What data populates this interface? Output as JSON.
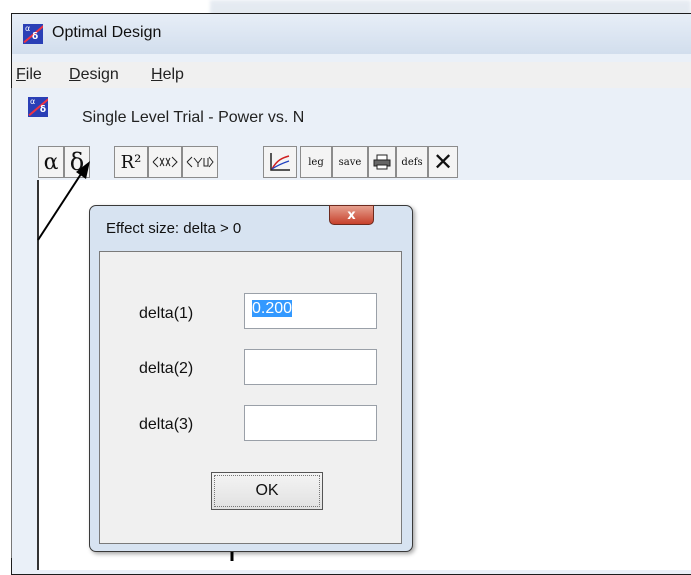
{
  "window": {
    "title": "Optimal Design"
  },
  "menu": [
    {
      "key": "F",
      "rest": "ile"
    },
    {
      "key": "D",
      "rest": "esign"
    },
    {
      "key": "H",
      "rest": "elp"
    }
  ],
  "child_window": {
    "title": "Single Level Trial - Power vs. N"
  },
  "toolbar": {
    "alpha": "α",
    "delta": "δ",
    "r2": "R²",
    "leg": "leg",
    "save": "save",
    "defs": "defs",
    "close": "✕"
  },
  "dialog": {
    "title": "Effect size: delta > 0",
    "close_glyph": "x",
    "fields": [
      {
        "label": "delta(1)",
        "value": "0.200"
      },
      {
        "label": "delta(2)",
        "value": ""
      },
      {
        "label": "delta(3)",
        "value": ""
      }
    ],
    "ok_label": "OK"
  }
}
